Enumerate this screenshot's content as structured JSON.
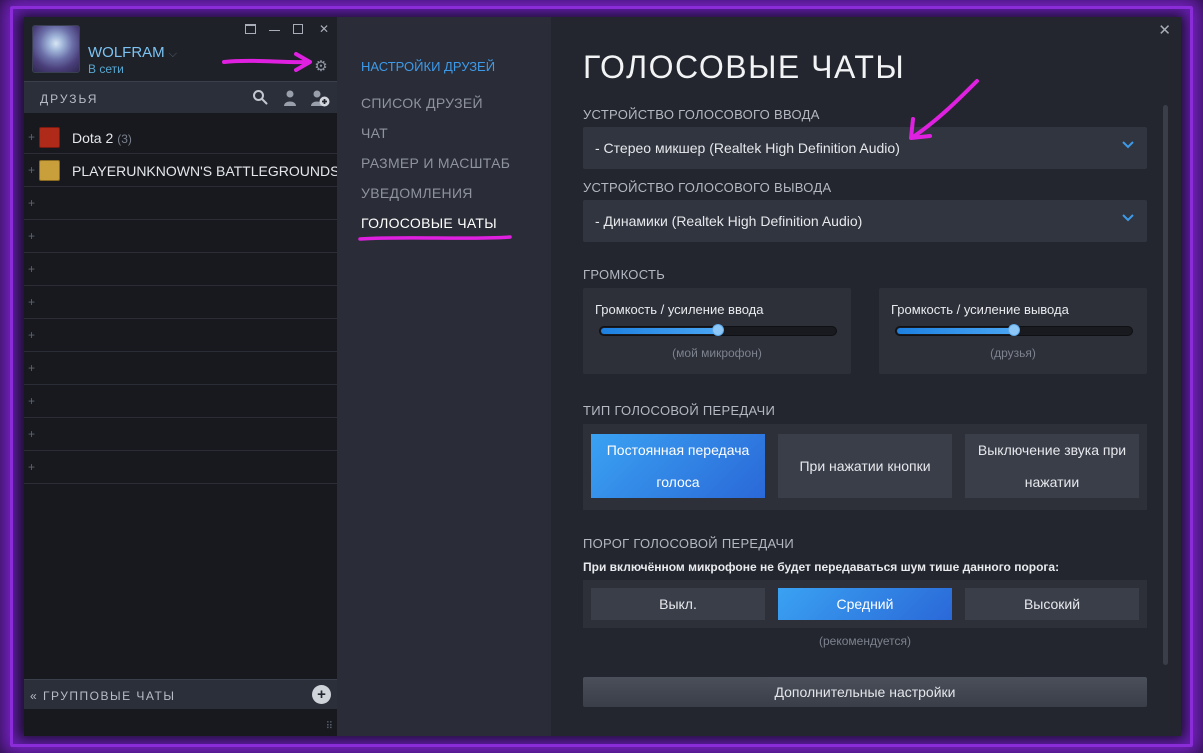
{
  "profile": {
    "username": "WOLFRAM",
    "status": "В сети"
  },
  "friends": {
    "header": "ДРУЗЬЯ",
    "groups": [
      {
        "name": "Dota 2",
        "count": "(3)",
        "icon": "dota2-icon"
      },
      {
        "name": "PLAYERUNKNOWN'S BATTLEGROUNDS (",
        "count": "",
        "icon": "pubg-icon"
      }
    ],
    "empty_rows": 9
  },
  "group_chats": {
    "header": "ГРУППОВЫЕ ЧАТЫ"
  },
  "nav": {
    "heading": "НАСТРОЙКИ ДРУЗЕЙ",
    "items": [
      {
        "label": "СПИСОК ДРУЗЕЙ",
        "active": false
      },
      {
        "label": "ЧАТ",
        "active": false
      },
      {
        "label": "РАЗМЕР И МАСШТАБ",
        "active": false
      },
      {
        "label": "УВЕДОМЛЕНИЯ",
        "active": false
      },
      {
        "label": "ГОЛОСОВЫЕ ЧАТЫ",
        "active": true
      }
    ]
  },
  "main": {
    "title": "ГОЛОСОВЫЕ ЧАТЫ",
    "input_device": {
      "label": "УСТРОЙСТВО ГОЛОСОВОГО ВВОДА",
      "value": "- Стерео микшер (Realtek High Definition Audio)"
    },
    "output_device": {
      "label": "УСТРОЙСТВО ГОЛОСОВОГО ВЫВОДА",
      "value": "- Динамики (Realtek High Definition Audio)"
    },
    "volume": {
      "label": "ГРОМКОСТЬ",
      "input": {
        "label": "Громкость / усиление ввода",
        "sub": "(мой микрофон)",
        "level": 0.5
      },
      "output": {
        "label": "Громкость / усиление вывода",
        "sub": "(друзья)",
        "level": 0.5
      }
    },
    "transmission": {
      "label": "ТИП ГОЛОСОВОЙ ПЕРЕДАЧИ",
      "options": [
        "Постоянная передача голоса",
        "При нажатии кнопки",
        "Выключение звука при нажатии"
      ],
      "selected": 0
    },
    "threshold": {
      "label": "ПОРОГ ГОЛОСОВОЙ ПЕРЕДАЧИ",
      "description": "При включённом микрофоне не будет передаваться шум тише данного порога:",
      "options": [
        "Выкл.",
        "Средний",
        "Высокий"
      ],
      "selected": 1,
      "recommended": "(рекомендуется)"
    },
    "advanced_button": "Дополнительные настройки"
  },
  "colors": {
    "accent": "#3d9ae8",
    "annotation": "#e020e0",
    "window_glow": "#8b2cd9"
  }
}
